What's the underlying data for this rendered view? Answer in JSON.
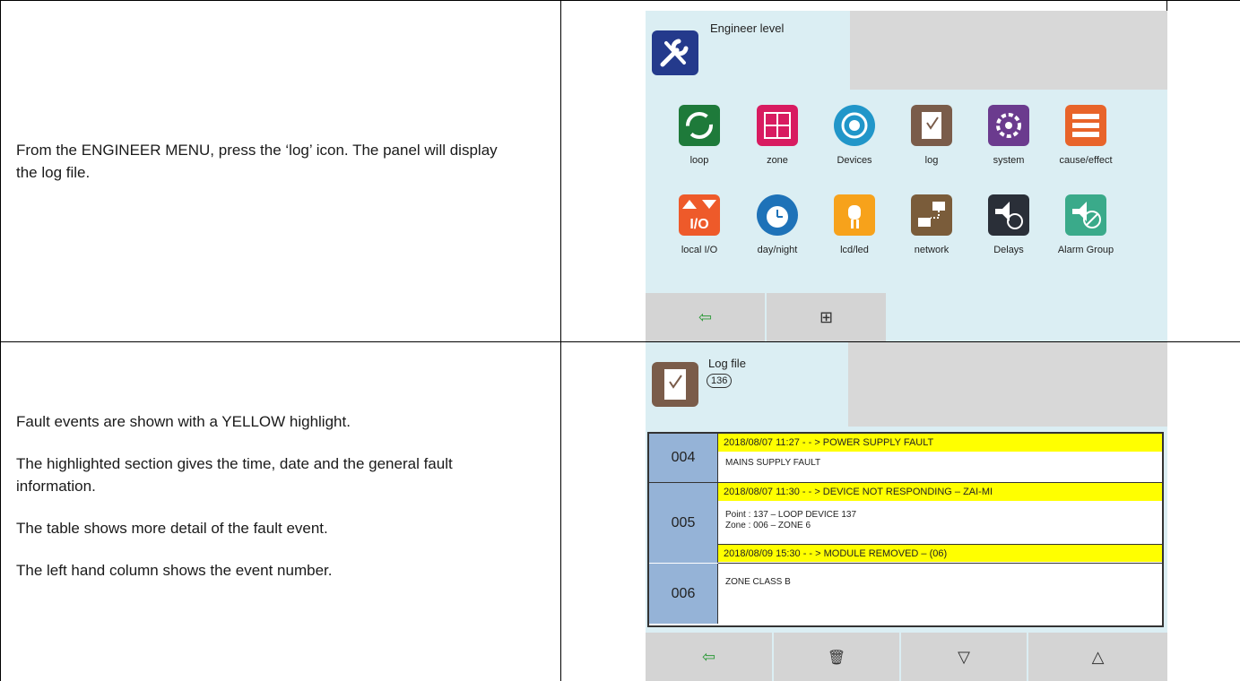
{
  "rows": [
    {
      "instructions": [
        "From the ENGINEER MENU, press the ‘log’ icon. The panel will display the log file."
      ]
    },
    {
      "instructions": [
        "Fault events are shown with a YELLOW highlight.",
        "The highlighted section gives the time, date and the general fault information.",
        "The table shows more detail of the fault event.",
        "The left hand column shows the event number."
      ]
    }
  ],
  "engineer_panel": {
    "title": "Engineer level",
    "icons": [
      {
        "label": "loop",
        "icon": "loop-icon",
        "color": "#1e7a3a"
      },
      {
        "label": "zone",
        "icon": "zone-icon",
        "color": "#d81b60"
      },
      {
        "label": "Devices",
        "icon": "devices-icon",
        "color": "#2196c9"
      },
      {
        "label": "log",
        "icon": "log-icon",
        "color": "#7a5c4a"
      },
      {
        "label": "system",
        "icon": "system-icon",
        "color": "#6b3b8e"
      },
      {
        "label": "cause/effect",
        "icon": "cause-effect-icon",
        "color": "#e8642a"
      },
      {
        "label": "local I/O",
        "icon": "local-io-icon",
        "color": "#ee5a2a"
      },
      {
        "label": "day/night",
        "icon": "day-night-icon",
        "color": "#1e72b8"
      },
      {
        "label": "lcd/led",
        "icon": "lcd-led-icon",
        "color": "#f7a21b"
      },
      {
        "label": "network",
        "icon": "network-icon",
        "color": "#7a5c3a"
      },
      {
        "label": "Delays",
        "icon": "delays-icon",
        "color": "#2a2f38"
      },
      {
        "label": "Alarm Group",
        "icon": "alarm-group-icon",
        "color": "#3aaa8a"
      }
    ],
    "buttons": [
      {
        "icon": "exit-icon",
        "glyph": "⇦"
      },
      {
        "icon": "add-folder-icon",
        "glyph": "⊞"
      }
    ]
  },
  "log_panel": {
    "title": "Log file",
    "count": "136",
    "events": [
      {
        "number": "004",
        "header": "2018/08/07    11:27  - - >  POWER SUPPLY FAULT",
        "details": [
          "MAINS SUPPLY FAULT"
        ]
      },
      {
        "number": "005",
        "header": "2018/08/07    11:30  - - >  DEVICE NOT RESPONDING – ZAI-MI",
        "details": [
          "Point  : 137 – LOOP DEVICE 137",
          "Zone   : 006 – ZONE 6"
        ]
      },
      {
        "number": "006",
        "header": "2018/08/09    15:30  - - >  MODULE REMOVED – (06)",
        "details": [
          "ZONE CLASS B"
        ]
      }
    ],
    "buttons": [
      {
        "icon": "exit-icon",
        "glyph": "⇦"
      },
      {
        "icon": "trash-icon",
        "glyph": "🗑"
      },
      {
        "icon": "scroll-down-icon",
        "glyph": "▽"
      },
      {
        "icon": "scroll-up-icon",
        "glyph": "△"
      }
    ]
  }
}
